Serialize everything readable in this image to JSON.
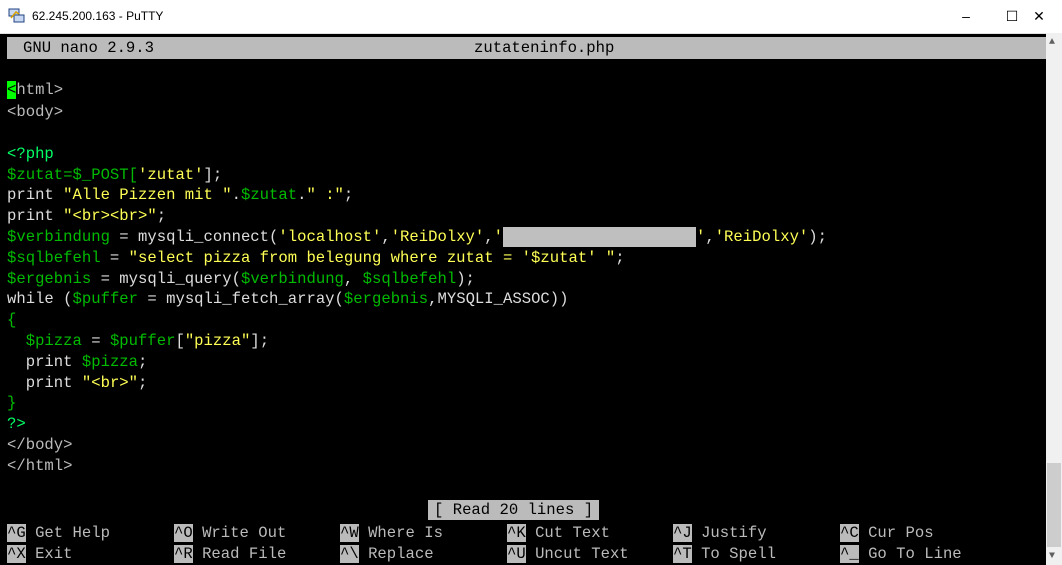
{
  "window": {
    "title": "62.245.200.163 - PuTTY",
    "controls": {
      "min": "–",
      "max": "☐",
      "close": "✕"
    }
  },
  "nano": {
    "header_left": "GNU nano 2.9.3",
    "filename": "zutateninfo.php",
    "status": "[ Read 20 lines ]"
  },
  "code": {
    "l1_cursor": "<",
    "l1_rest": "html>",
    "l2": "<body>",
    "l4": "<?php",
    "l5_var": "$zutat=$_POST[",
    "l5_str": "'zutat'",
    "l5_end": "];",
    "l6_kw": "print ",
    "l6_str1": "\"Alle Pizzen mit \"",
    "l6_dot1": ".",
    "l6_var": "$zutat",
    "l6_dot2": ".",
    "l6_str2": "\" :\"",
    "l6_end": ";",
    "l7_kw": "print ",
    "l7_str": "\"<br><br>\"",
    "l7_end": ";",
    "l8_var": "$verbindung",
    "l8_mid": " = mysqli_connect(",
    "l8_str1": "'localhost'",
    "l8_c1": ",",
    "l8_str2": "'ReiDolxy'",
    "l8_c2": ",",
    "l8_str3a": "'",
    "l8_str3b": "'",
    "l8_c3": ",",
    "l8_str4": "'ReiDolxy'",
    "l8_end": ");",
    "l9_var": "$sqlbefehl",
    "l9_mid": " = ",
    "l9_str": "\"select pizza from belegung where zutat = '$zutat' \"",
    "l9_end": ";",
    "l10_var": "$ergebnis",
    "l10_mid": " = mysqli_query(",
    "l10_var2": "$verbindung",
    "l10_c": ", ",
    "l10_var3": "$sqlbefehl",
    "l10_end": ");",
    "l11_kw": "while (",
    "l11_var": "$puffer",
    "l11_mid": " = mysqli_fetch_array(",
    "l11_var2": "$ergebnis",
    "l11_end": ",MYSQLI_ASSOC))",
    "l12": "{",
    "l13_var": "  $pizza",
    "l13_mid": " = ",
    "l13_var2": "$puffer",
    "l13_br": "[",
    "l13_str": "\"pizza\"",
    "l13_end": "];",
    "l14_kw": "  print ",
    "l14_var": "$pizza",
    "l14_end": ";",
    "l15_kw": "  print ",
    "l15_str": "\"<br>\"",
    "l15_end": ";",
    "l16": "}",
    "l17": "?>",
    "l18": "</body>",
    "l19": "</html>"
  },
  "shortcuts": [
    {
      "key": "^G",
      "label": "Get Help"
    },
    {
      "key": "^O",
      "label": "Write Out"
    },
    {
      "key": "^W",
      "label": "Where Is"
    },
    {
      "key": "^K",
      "label": "Cut Text"
    },
    {
      "key": "^J",
      "label": "Justify"
    },
    {
      "key": "^C",
      "label": "Cur Pos"
    },
    {
      "key": "^X",
      "label": "Exit"
    },
    {
      "key": "^R",
      "label": "Read File"
    },
    {
      "key": "^\\",
      "label": "Replace"
    },
    {
      "key": "^U",
      "label": "Uncut Text"
    },
    {
      "key": "^T",
      "label": "To Spell"
    },
    {
      "key": "^_",
      "label": "Go To Line"
    }
  ],
  "colors": {
    "keyword": "#ffff55",
    "variable": "#00bb00",
    "php_tag": "#00ff66",
    "cursor": "#00ff00"
  }
}
